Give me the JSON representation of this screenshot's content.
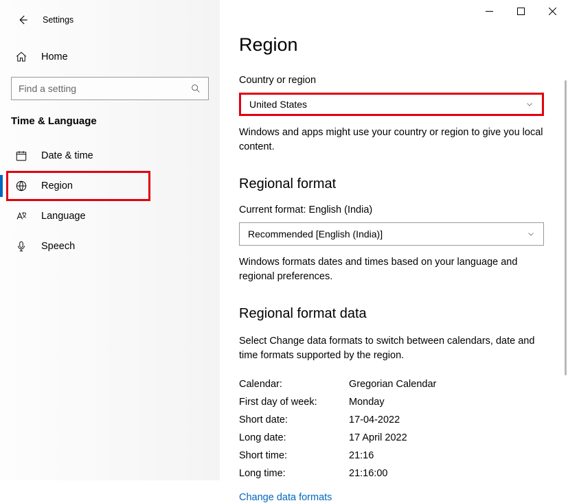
{
  "app_title": "Settings",
  "home_label": "Home",
  "search_placeholder": "Find a setting",
  "section_header": "Time & Language",
  "nav": [
    {
      "label": "Date & time"
    },
    {
      "label": "Region"
    },
    {
      "label": "Language"
    },
    {
      "label": "Speech"
    }
  ],
  "page_title": "Region",
  "country_section": {
    "label": "Country or region",
    "value": "United States",
    "help": "Windows and apps might use your country or region to give you local content."
  },
  "format_section": {
    "heading": "Regional format",
    "current_label": "Current format: English (India)",
    "value": "Recommended [English (India)]",
    "help": "Windows formats dates and times based on your language and regional preferences."
  },
  "data_section": {
    "heading": "Regional format data",
    "intro": "Select Change data formats to switch between calendars, date and time formats supported by the region.",
    "rows": [
      {
        "k": "Calendar:",
        "v": "Gregorian Calendar"
      },
      {
        "k": "First day of week:",
        "v": "Monday"
      },
      {
        "k": "Short date:",
        "v": "17-04-2022"
      },
      {
        "k": "Long date:",
        "v": "17 April 2022"
      },
      {
        "k": "Short time:",
        "v": "21:16"
      },
      {
        "k": "Long time:",
        "v": "21:16:00"
      }
    ],
    "link": "Change data formats"
  }
}
